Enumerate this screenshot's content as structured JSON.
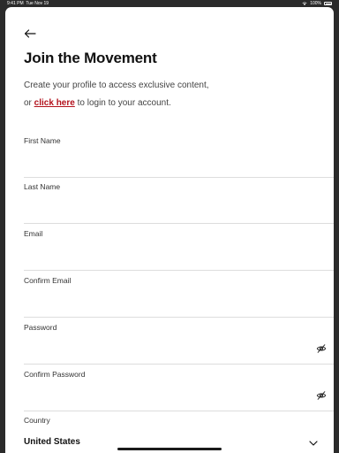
{
  "status_bar": {
    "time": "9:41 PM",
    "date": "Tue Nov 19",
    "battery": "100%"
  },
  "header": {
    "title": "Join the Movement"
  },
  "intro": {
    "line1": "Create your profile to access exclusive content,",
    "prefix": "or ",
    "link": "click here",
    "suffix": " to login to your account."
  },
  "form": {
    "first_name": {
      "label": "First Name",
      "value": ""
    },
    "last_name": {
      "label": "Last Name",
      "value": ""
    },
    "email": {
      "label": "Email",
      "value": ""
    },
    "confirm_email": {
      "label": "Confirm Email",
      "value": ""
    },
    "password": {
      "label": "Password",
      "value": ""
    },
    "confirm_password": {
      "label": "Confirm Password",
      "value": ""
    },
    "country": {
      "label": "Country",
      "value": "United States"
    }
  },
  "icons": {
    "back": "arrow-left-icon",
    "password_toggle": "eye-off-icon",
    "dropdown": "chevron-down-icon"
  },
  "colors": {
    "link": "#b3121c",
    "divider": "#dddddd",
    "background": "#2b2b2b"
  }
}
